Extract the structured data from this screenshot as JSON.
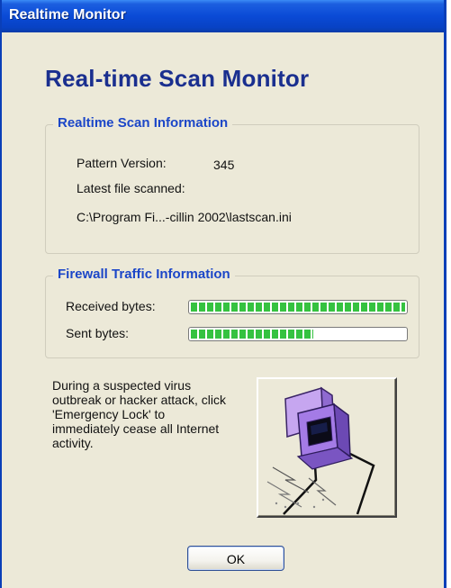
{
  "window": {
    "title": "Realtime Monitor"
  },
  "heading": "Real-time Scan Monitor",
  "scan_info": {
    "title": "Realtime Scan Information",
    "pattern_version_label": "Pattern Version:",
    "pattern_version_value": "345",
    "latest_file_label": "Latest file scanned:",
    "latest_file_value": "C:\\Program Fi...-cillin 2002\\lastscan.ini"
  },
  "firewall": {
    "title": "Firewall Traffic Information",
    "received_label": "Received bytes:",
    "received_level_percent": 100,
    "sent_label": "Sent bytes:",
    "sent_level_percent": 57,
    "bar_color": "#35C240"
  },
  "emergency": {
    "note": "During a suspected virus outbreak or hacker attack, click 'Emergency Lock' to immediately cease all Internet activity.",
    "icon": "emergency-lock-icon"
  },
  "buttons": {
    "ok_label": "OK"
  }
}
